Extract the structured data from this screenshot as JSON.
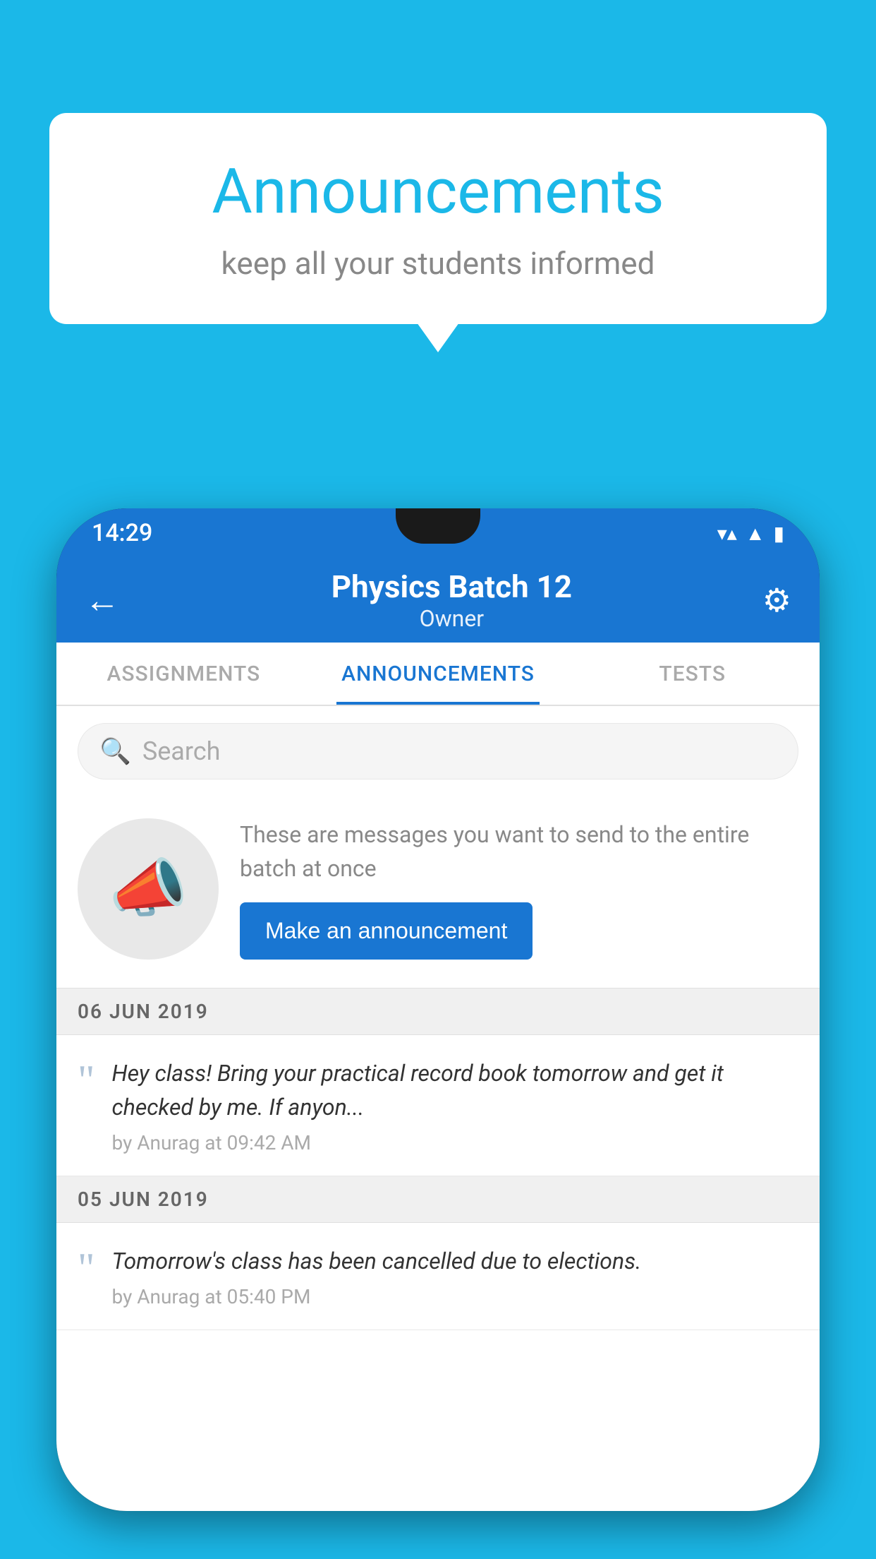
{
  "background_color": "#1BB8E8",
  "speech_bubble": {
    "title": "Announcements",
    "subtitle": "keep all your students informed"
  },
  "phone": {
    "status_bar": {
      "time": "14:29",
      "wifi_icon": "wifi",
      "signal_icon": "signal",
      "battery_icon": "battery"
    },
    "app_bar": {
      "title": "Physics Batch 12",
      "subtitle": "Owner",
      "back_label": "←",
      "gear_label": "⚙"
    },
    "tabs": [
      {
        "label": "ASSIGNMENTS",
        "active": false
      },
      {
        "label": "ANNOUNCEMENTS",
        "active": true
      },
      {
        "label": "TESTS",
        "active": false
      }
    ],
    "search": {
      "placeholder": "Search"
    },
    "announcement_prompt": {
      "description_text": "These are messages you want to send to the entire batch at once",
      "button_label": "Make an announcement"
    },
    "messages": [
      {
        "date": "06  JUN  2019",
        "text": "Hey class! Bring your practical record book tomorrow and get it checked by me. If anyon...",
        "meta": "by Anurag at 09:42 AM"
      },
      {
        "date": "05  JUN  2019",
        "text": "Tomorrow's class has been cancelled due to elections.",
        "meta": "by Anurag at 05:40 PM"
      }
    ]
  }
}
